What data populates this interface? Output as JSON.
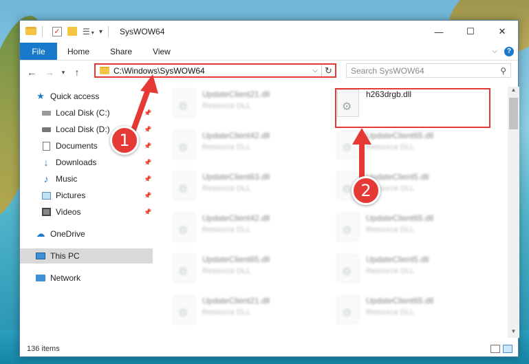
{
  "window": {
    "title": "SysWOW64",
    "controls": {
      "minimize": "—",
      "maximize": "☐",
      "close": "✕"
    }
  },
  "ribbon": {
    "file_label": "File",
    "tabs": [
      "Home",
      "Share",
      "View"
    ]
  },
  "address": {
    "path": "C:\\Windows\\SysWOW64",
    "refresh_icon": "↻",
    "dropdown_icon": "⌵"
  },
  "search": {
    "placeholder": "Search SysWOW64"
  },
  "nav": {
    "items": [
      {
        "label": "Quick access",
        "icon": "star-icon"
      },
      {
        "label": "Local Disk (C:)",
        "icon": "drive-icon"
      },
      {
        "label": "Local Disk (D:)",
        "icon": "drive-icon"
      },
      {
        "label": "Documents",
        "icon": "documents-icon"
      },
      {
        "label": "Downloads",
        "icon": "download-icon"
      },
      {
        "label": "Music",
        "icon": "music-icon"
      },
      {
        "label": "Pictures",
        "icon": "pictures-icon"
      },
      {
        "label": "Videos",
        "icon": "videos-icon"
      },
      {
        "label": "OneDrive",
        "icon": "cloud-icon"
      },
      {
        "label": "This PC",
        "icon": "computer-icon"
      },
      {
        "label": "Network",
        "icon": "network-icon"
      }
    ]
  },
  "files": [
    {
      "name": "UpdateClient21.dll",
      "type": "Resource DLL"
    },
    {
      "name": "h263drgb.dll",
      "type": ""
    },
    {
      "name": "UpdateClient42.dll",
      "type": "Resource DLL"
    },
    {
      "name": "UpdateClient65.dll",
      "type": "Resource DLL"
    },
    {
      "name": "UpdateClient63.dll",
      "type": "Resource DLL"
    },
    {
      "name": "UpdateClient5.dll",
      "type": "Resource DLL"
    },
    {
      "name": "UpdateClient42.dll",
      "type": "Resource DLL"
    },
    {
      "name": "UpdateClient65.dll",
      "type": "Resource DLL"
    },
    {
      "name": "UpdateClient65.dll",
      "type": "Resource DLL"
    },
    {
      "name": "UpdateClient5.dll",
      "type": "Resource DLL"
    },
    {
      "name": "UpdateClient21.dll",
      "type": "Resource DLL"
    },
    {
      "name": "UpdateClient65.dll",
      "type": "Resource DLL"
    }
  ],
  "status": {
    "item_count": "136 items"
  },
  "annotations": {
    "step1": "1",
    "step2": "2",
    "color": "#e53935"
  }
}
